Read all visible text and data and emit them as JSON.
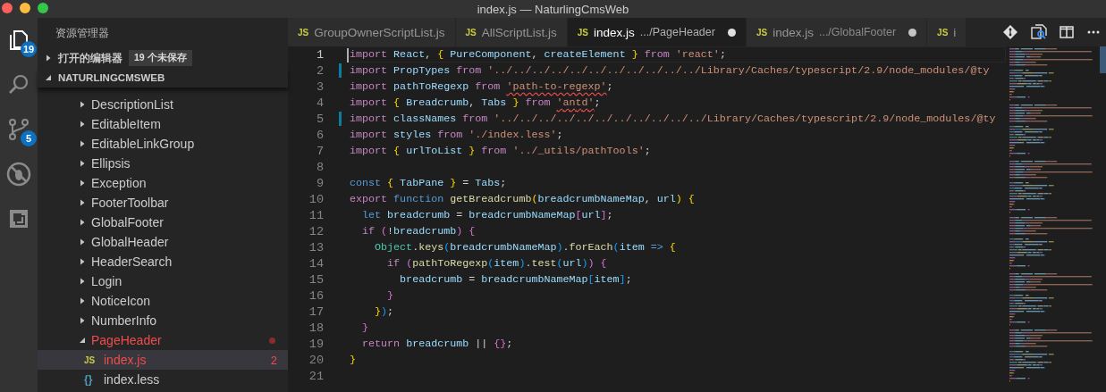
{
  "window": {
    "title": "index.js — NaturlingCmsWeb"
  },
  "activity_bar": [
    {
      "kind": "explorer",
      "selected": true,
      "badge": "19"
    },
    {
      "kind": "search",
      "selected": false
    },
    {
      "kind": "source-control",
      "selected": false,
      "badge": "5"
    },
    {
      "kind": "debug",
      "selected": false
    },
    {
      "kind": "extensions",
      "selected": false
    }
  ],
  "sidebar": {
    "title": "资源管理器",
    "open_editors": {
      "label": "打开的编辑器",
      "expanded": false,
      "badge": "19 个未保存"
    },
    "project": {
      "label": "NATURLINGCMSWEB",
      "expanded": true,
      "children": [
        {
          "kind": "folder",
          "name": "DescriptionList",
          "expanded": false,
          "error": false,
          "selected": false
        },
        {
          "kind": "folder",
          "name": "EditableItem",
          "expanded": false,
          "error": false,
          "selected": false
        },
        {
          "kind": "folder",
          "name": "EditableLinkGroup",
          "expanded": false,
          "error": false,
          "selected": false
        },
        {
          "kind": "folder",
          "name": "Ellipsis",
          "expanded": false,
          "error": false,
          "selected": false
        },
        {
          "kind": "folder",
          "name": "Exception",
          "expanded": false,
          "error": false,
          "selected": false
        },
        {
          "kind": "folder",
          "name": "FooterToolbar",
          "expanded": false,
          "error": false,
          "selected": false
        },
        {
          "kind": "folder",
          "name": "GlobalFooter",
          "expanded": false,
          "error": false,
          "selected": false
        },
        {
          "kind": "folder",
          "name": "GlobalHeader",
          "expanded": false,
          "error": false,
          "selected": false
        },
        {
          "kind": "folder",
          "name": "HeaderSearch",
          "expanded": false,
          "error": false,
          "selected": false
        },
        {
          "kind": "folder",
          "name": "Login",
          "expanded": false,
          "error": false,
          "selected": false
        },
        {
          "kind": "folder",
          "name": "NoticeIcon",
          "expanded": false,
          "error": false,
          "selected": false
        },
        {
          "kind": "folder",
          "name": "NumberInfo",
          "expanded": false,
          "error": false,
          "selected": false
        },
        {
          "kind": "folder",
          "name": "PageHeader",
          "expanded": true,
          "error": true,
          "selected": false,
          "children": [
            {
              "kind": "js-file",
              "icon": "JS",
              "name": "index.js",
              "error": true,
              "selected": true,
              "problems": "2"
            },
            {
              "kind": "less-file",
              "icon": "{}",
              "name": "index.less",
              "error": false,
              "selected": false
            }
          ]
        }
      ]
    }
  },
  "tabs": [
    {
      "icon": "JS",
      "label": "GroupOwnerScriptList.js",
      "selected": false,
      "dirty": false
    },
    {
      "icon": "JS",
      "label": "AllScriptList.js",
      "selected": false,
      "dirty": false
    },
    {
      "icon": "JS",
      "label": "index.js",
      "description": ".../PageHeader",
      "selected": true,
      "dirty": true
    },
    {
      "icon": "JS",
      "label": "index.js",
      "description": ".../GlobalFooter",
      "selected": false,
      "dirty": true
    },
    {
      "icon": "JS",
      "label": "i",
      "selected": false,
      "dirty": false
    }
  ],
  "editor": {
    "lines": [
      {
        "number": "1",
        "current": true,
        "modified": false,
        "tokens": [
          {
            "kind": "control",
            "text": "import "
          },
          {
            "kind": "variable",
            "text": "React"
          },
          {
            "kind": "plain",
            "text": ", "
          },
          {
            "kind": "bracket1",
            "text": "{"
          },
          {
            "kind": "variable",
            "text": " PureComponent"
          },
          {
            "kind": "plain",
            "text": ", "
          },
          {
            "kind": "variable",
            "text": "createElement "
          },
          {
            "kind": "bracket1",
            "text": "}"
          },
          {
            "kind": "control",
            "text": " from "
          },
          {
            "kind": "string",
            "text": "'react'"
          },
          {
            "kind": "plain",
            "text": ";"
          }
        ]
      },
      {
        "number": "2",
        "current": false,
        "modified": true,
        "tokens": [
          {
            "kind": "control",
            "text": "import "
          },
          {
            "kind": "variable",
            "text": "PropTypes"
          },
          {
            "kind": "control",
            "text": " from "
          },
          {
            "kind": "string",
            "text": "'../../../../../../../../../../../Library/Caches/typescript/2.9/node_modules/@ty"
          }
        ]
      },
      {
        "number": "3",
        "current": false,
        "modified": false,
        "tokens": [
          {
            "kind": "control",
            "text": "import "
          },
          {
            "kind": "variable",
            "text": "pathToRegexp"
          },
          {
            "kind": "control",
            "text": " from "
          },
          {
            "kind": "string",
            "text": "'path-to-regexp'",
            "squiggle": true
          },
          {
            "kind": "plain",
            "text": ";"
          }
        ]
      },
      {
        "number": "4",
        "current": false,
        "modified": false,
        "tokens": [
          {
            "kind": "control",
            "text": "import "
          },
          {
            "kind": "bracket1",
            "text": "{"
          },
          {
            "kind": "variable",
            "text": " Breadcrumb"
          },
          {
            "kind": "plain",
            "text": ", "
          },
          {
            "kind": "variable",
            "text": "Tabs "
          },
          {
            "kind": "bracket1",
            "text": "}"
          },
          {
            "kind": "control",
            "text": " from "
          },
          {
            "kind": "string",
            "text": "'antd'",
            "squiggle": true
          },
          {
            "kind": "plain",
            "text": ";"
          }
        ]
      },
      {
        "number": "5",
        "current": false,
        "modified": true,
        "tokens": [
          {
            "kind": "control",
            "text": "import "
          },
          {
            "kind": "variable",
            "text": "classNames"
          },
          {
            "kind": "control",
            "text": " from "
          },
          {
            "kind": "string",
            "text": "'../../../../../../../../../../../Library/Caches/typescript/2.9/node_modules/@ty"
          }
        ]
      },
      {
        "number": "6",
        "current": false,
        "modified": false,
        "tokens": [
          {
            "kind": "control",
            "text": "import "
          },
          {
            "kind": "variable",
            "text": "styles"
          },
          {
            "kind": "control",
            "text": " from "
          },
          {
            "kind": "string",
            "text": "'./index.less'"
          },
          {
            "kind": "plain",
            "text": ";"
          }
        ]
      },
      {
        "number": "7",
        "current": false,
        "modified": false,
        "tokens": [
          {
            "kind": "control",
            "text": "import "
          },
          {
            "kind": "bracket1",
            "text": "{"
          },
          {
            "kind": "variable",
            "text": " urlToList "
          },
          {
            "kind": "bracket1",
            "text": "}"
          },
          {
            "kind": "control",
            "text": " from "
          },
          {
            "kind": "string",
            "text": "'../_utils/pathTools'"
          },
          {
            "kind": "plain",
            "text": ";"
          }
        ]
      },
      {
        "number": "8",
        "current": false,
        "modified": false
      },
      {
        "number": "9",
        "current": false,
        "modified": false,
        "tokens": [
          {
            "kind": "storage",
            "text": "const "
          },
          {
            "kind": "bracket1",
            "text": "{"
          },
          {
            "kind": "variable",
            "text": " TabPane "
          },
          {
            "kind": "bracket1",
            "text": "}"
          },
          {
            "kind": "plain",
            "text": " = "
          },
          {
            "kind": "variable",
            "text": "Tabs"
          },
          {
            "kind": "plain",
            "text": ";"
          }
        ]
      },
      {
        "number": "10",
        "current": false,
        "modified": false,
        "tokens": [
          {
            "kind": "control",
            "text": "export "
          },
          {
            "kind": "storage",
            "text": "function "
          },
          {
            "kind": "function",
            "text": "getBreadcrumb"
          },
          {
            "kind": "bracket1",
            "text": "("
          },
          {
            "kind": "variable",
            "text": "breadcrumbNameMap"
          },
          {
            "kind": "plain",
            "text": ", "
          },
          {
            "kind": "variable",
            "text": "url"
          },
          {
            "kind": "bracket1",
            "text": ")"
          },
          {
            "kind": "bracket1",
            "text": " {"
          }
        ]
      },
      {
        "number": "11",
        "current": false,
        "modified": false,
        "tokens": [
          {
            "kind": "storage",
            "text": "  let "
          },
          {
            "kind": "variable",
            "text": "breadcrumb"
          },
          {
            "kind": "plain",
            "text": " = "
          },
          {
            "kind": "variable",
            "text": "breadcrumbNameMap"
          },
          {
            "kind": "bracket2",
            "text": "["
          },
          {
            "kind": "variable",
            "text": "url"
          },
          {
            "kind": "bracket2",
            "text": "]"
          },
          {
            "kind": "plain",
            "text": ";"
          }
        ]
      },
      {
        "number": "12",
        "current": false,
        "modified": false,
        "tokens": [
          {
            "kind": "control",
            "text": "  if "
          },
          {
            "kind": "bracket2",
            "text": "("
          },
          {
            "kind": "plain",
            "text": "!"
          },
          {
            "kind": "variable",
            "text": "breadcrumb"
          },
          {
            "kind": "bracket2",
            "text": ")"
          },
          {
            "kind": "bracket2",
            "text": " {"
          }
        ]
      },
      {
        "number": "13",
        "current": false,
        "modified": false,
        "tokens": [
          {
            "kind": "class",
            "text": "    Object"
          },
          {
            "kind": "plain",
            "text": "."
          },
          {
            "kind": "function",
            "text": "keys"
          },
          {
            "kind": "bracket3",
            "text": "("
          },
          {
            "kind": "variable",
            "text": "breadcrumbNameMap"
          },
          {
            "kind": "bracket3",
            "text": ")"
          },
          {
            "kind": "plain",
            "text": "."
          },
          {
            "kind": "function",
            "text": "forEach"
          },
          {
            "kind": "bracket3",
            "text": "("
          },
          {
            "kind": "variable",
            "text": "item "
          },
          {
            "kind": "storage",
            "text": "=>"
          },
          {
            "kind": "bracket1",
            "text": " {"
          }
        ]
      },
      {
        "number": "14",
        "current": false,
        "modified": false,
        "tokens": [
          {
            "kind": "control",
            "text": "      if "
          },
          {
            "kind": "bracket2",
            "text": "("
          },
          {
            "kind": "function",
            "text": "pathToRegexp"
          },
          {
            "kind": "bracket3",
            "text": "("
          },
          {
            "kind": "variable",
            "text": "item"
          },
          {
            "kind": "bracket3",
            "text": ")"
          },
          {
            "kind": "plain",
            "text": "."
          },
          {
            "kind": "function",
            "text": "test"
          },
          {
            "kind": "bracket3",
            "text": "("
          },
          {
            "kind": "variable",
            "text": "url"
          },
          {
            "kind": "bracket3",
            "text": ")"
          },
          {
            "kind": "bracket2",
            "text": ")"
          },
          {
            "kind": "bracket2",
            "text": " {"
          }
        ]
      },
      {
        "number": "15",
        "current": false,
        "modified": false,
        "tokens": [
          {
            "kind": "variable",
            "text": "        breadcrumb"
          },
          {
            "kind": "plain",
            "text": " = "
          },
          {
            "kind": "variable",
            "text": "breadcrumbNameMap"
          },
          {
            "kind": "bracket3",
            "text": "["
          },
          {
            "kind": "variable",
            "text": "item"
          },
          {
            "kind": "bracket3",
            "text": "]"
          },
          {
            "kind": "plain",
            "text": ";"
          }
        ]
      },
      {
        "number": "16",
        "current": false,
        "modified": false,
        "tokens": [
          {
            "kind": "bracket2",
            "text": "      }"
          }
        ]
      },
      {
        "number": "17",
        "current": false,
        "modified": false,
        "tokens": [
          {
            "kind": "bracket1",
            "text": "    }"
          },
          {
            "kind": "bracket3",
            "text": ")"
          },
          {
            "kind": "plain",
            "text": ";"
          }
        ]
      },
      {
        "number": "18",
        "current": false,
        "modified": false,
        "tokens": [
          {
            "kind": "bracket2",
            "text": "  }"
          }
        ]
      },
      {
        "number": "19",
        "current": false,
        "modified": false,
        "tokens": [
          {
            "kind": "control",
            "text": "  return "
          },
          {
            "kind": "variable",
            "text": "breadcrumb "
          },
          {
            "kind": "plain",
            "text": "|| "
          },
          {
            "kind": "bracket2",
            "text": "{}"
          },
          {
            "kind": "plain",
            "text": ";"
          }
        ]
      },
      {
        "number": "20",
        "current": false,
        "modified": false,
        "tokens": [
          {
            "kind": "bracket1",
            "text": "}"
          }
        ]
      },
      {
        "number": "21",
        "current": false,
        "modified": false
      }
    ]
  }
}
